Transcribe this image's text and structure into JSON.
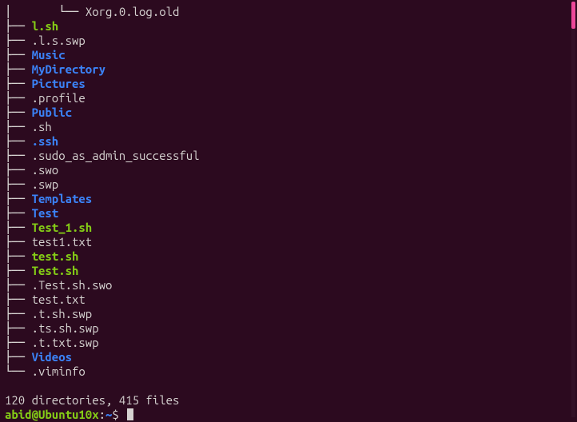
{
  "tree": {
    "deep_branch": "│       └── ",
    "mid_branch": "├── ",
    "last_branch": "└── ",
    "rows": [
      {
        "depth": "deep",
        "edge": "last",
        "cls": "file",
        "name": "Xorg.0.log.old"
      },
      {
        "depth": "top",
        "edge": "mid",
        "cls": "exec",
        "name": "l.sh"
      },
      {
        "depth": "top",
        "edge": "mid",
        "cls": "file",
        "name": ".l.s.swp"
      },
      {
        "depth": "top",
        "edge": "mid",
        "cls": "dir",
        "name": "Music"
      },
      {
        "depth": "top",
        "edge": "mid",
        "cls": "dir",
        "name": "MyDirectory"
      },
      {
        "depth": "top",
        "edge": "mid",
        "cls": "dir",
        "name": "Pictures"
      },
      {
        "depth": "top",
        "edge": "mid",
        "cls": "file",
        "name": ".profile"
      },
      {
        "depth": "top",
        "edge": "mid",
        "cls": "dir",
        "name": "Public"
      },
      {
        "depth": "top",
        "edge": "mid",
        "cls": "file",
        "name": ".sh"
      },
      {
        "depth": "top",
        "edge": "mid",
        "cls": "dir",
        "name": ".ssh"
      },
      {
        "depth": "top",
        "edge": "mid",
        "cls": "file",
        "name": ".sudo_as_admin_successful"
      },
      {
        "depth": "top",
        "edge": "mid",
        "cls": "file",
        "name": ".swo"
      },
      {
        "depth": "top",
        "edge": "mid",
        "cls": "file",
        "name": ".swp"
      },
      {
        "depth": "top",
        "edge": "mid",
        "cls": "dir",
        "name": "Templates"
      },
      {
        "depth": "top",
        "edge": "mid",
        "cls": "dir",
        "name": "Test"
      },
      {
        "depth": "top",
        "edge": "mid",
        "cls": "exec",
        "name": "Test_1.sh"
      },
      {
        "depth": "top",
        "edge": "mid",
        "cls": "file",
        "name": "test1.txt"
      },
      {
        "depth": "top",
        "edge": "mid",
        "cls": "exec",
        "name": "test.sh"
      },
      {
        "depth": "top",
        "edge": "mid",
        "cls": "exec",
        "name": "Test.sh"
      },
      {
        "depth": "top",
        "edge": "mid",
        "cls": "file",
        "name": ".Test.sh.swo"
      },
      {
        "depth": "top",
        "edge": "mid",
        "cls": "file",
        "name": "test.txt"
      },
      {
        "depth": "top",
        "edge": "mid",
        "cls": "file",
        "name": ".t.sh.swp"
      },
      {
        "depth": "top",
        "edge": "mid",
        "cls": "file",
        "name": ".ts.sh.swp"
      },
      {
        "depth": "top",
        "edge": "mid",
        "cls": "file",
        "name": ".t.txt.swp"
      },
      {
        "depth": "top",
        "edge": "mid",
        "cls": "dir",
        "name": "Videos"
      },
      {
        "depth": "top",
        "edge": "last",
        "cls": "file",
        "name": ".viminfo"
      }
    ]
  },
  "summary": "120 directories, 415 files",
  "prompt": {
    "user_host": "abid@Ubuntu10x",
    "colon": ":",
    "cwd": "~",
    "dollar": "$ "
  }
}
